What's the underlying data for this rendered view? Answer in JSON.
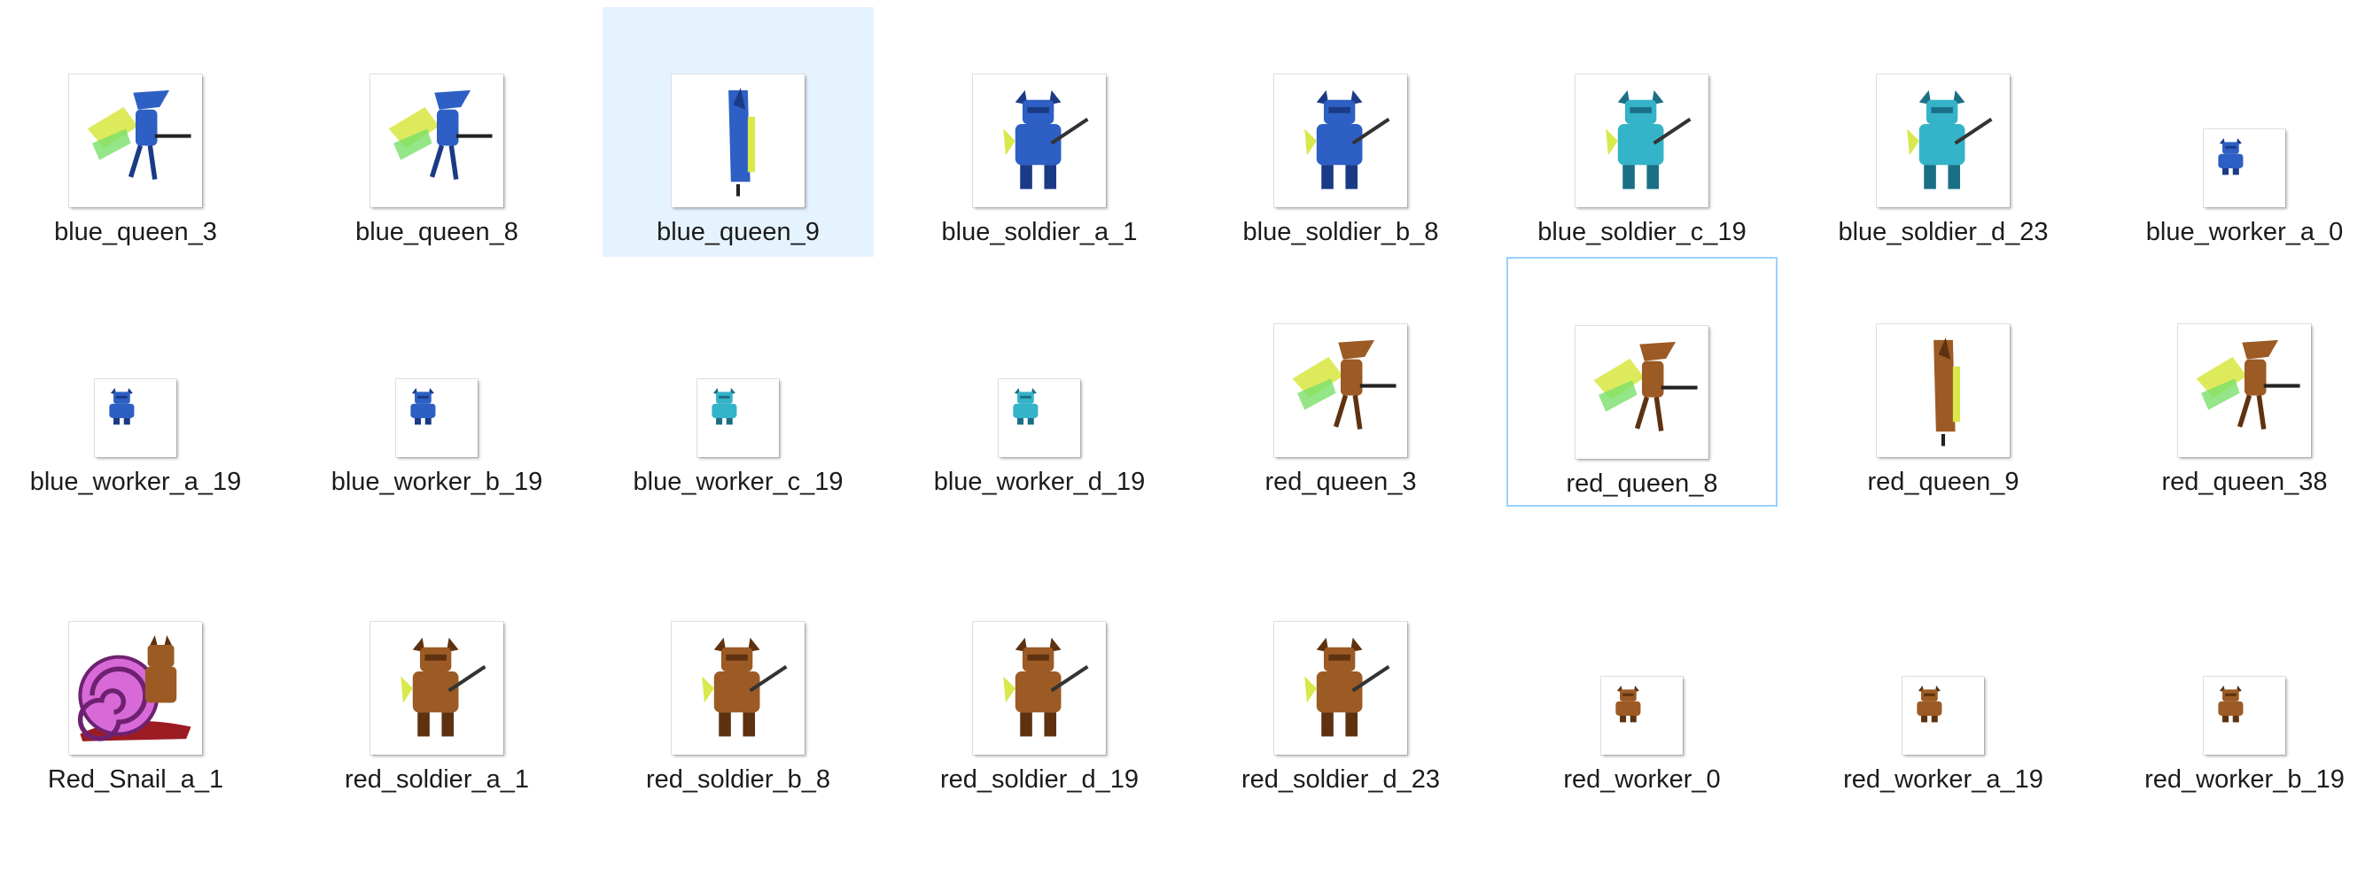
{
  "explorer": {
    "selected_index": 2,
    "focused_index": 13,
    "files": [
      {
        "name": "blue_queen_3",
        "icon": "blue-queen-sprite-icon",
        "kind": "queen",
        "team": "blue"
      },
      {
        "name": "blue_queen_8",
        "icon": "blue-queen-sprite-icon",
        "kind": "queen",
        "team": "blue"
      },
      {
        "name": "blue_queen_9",
        "icon": "blue-queen-sprite-icon",
        "kind": "queen-side",
        "team": "blue"
      },
      {
        "name": "blue_soldier_a_1",
        "icon": "blue-soldier-sprite-icon",
        "kind": "soldier",
        "team": "blue"
      },
      {
        "name": "blue_soldier_b_8",
        "icon": "blue-soldier-sprite-icon",
        "kind": "soldier",
        "team": "blue"
      },
      {
        "name": "blue_soldier_c_19",
        "icon": "blue-soldier-sprite-icon",
        "kind": "soldier",
        "team": "teal"
      },
      {
        "name": "blue_soldier_d_23",
        "icon": "blue-soldier-sprite-icon",
        "kind": "soldier",
        "team": "teal"
      },
      {
        "name": "blue_worker_a_0",
        "icon": "blue-worker-sprite-icon",
        "kind": "worker",
        "team": "blue"
      },
      {
        "name": "blue_worker_a_19",
        "icon": "blue-worker-sprite-icon",
        "kind": "worker",
        "team": "blue"
      },
      {
        "name": "blue_worker_b_19",
        "icon": "blue-worker-sprite-icon",
        "kind": "worker",
        "team": "blue"
      },
      {
        "name": "blue_worker_c_19",
        "icon": "blue-worker-sprite-icon",
        "kind": "worker",
        "team": "teal"
      },
      {
        "name": "blue_worker_d_19",
        "icon": "blue-worker-sprite-icon",
        "kind": "worker",
        "team": "teal"
      },
      {
        "name": "red_queen_3",
        "icon": "red-queen-sprite-icon",
        "kind": "queen",
        "team": "red"
      },
      {
        "name": "red_queen_8",
        "icon": "red-queen-sprite-icon",
        "kind": "queen",
        "team": "red"
      },
      {
        "name": "red_queen_9",
        "icon": "red-queen-sprite-icon",
        "kind": "queen-side",
        "team": "red"
      },
      {
        "name": "red_queen_38",
        "icon": "red-queen-sprite-icon",
        "kind": "queen",
        "team": "red"
      },
      {
        "name": "Red_Snail_a_1",
        "icon": "red-snail-sprite-icon",
        "kind": "snail",
        "team": "red"
      },
      {
        "name": "red_soldier_a_1",
        "icon": "red-soldier-sprite-icon",
        "kind": "soldier",
        "team": "red"
      },
      {
        "name": "red_soldier_b_8",
        "icon": "red-soldier-sprite-icon",
        "kind": "soldier",
        "team": "red"
      },
      {
        "name": "red_soldier_d_19",
        "icon": "red-soldier-sprite-icon",
        "kind": "soldier",
        "team": "red"
      },
      {
        "name": "red_soldier_d_23",
        "icon": "red-soldier-sprite-icon",
        "kind": "soldier",
        "team": "red"
      },
      {
        "name": "red_worker_0",
        "icon": "red-worker-sprite-icon",
        "kind": "worker",
        "team": "red"
      },
      {
        "name": "red_worker_a_19",
        "icon": "red-worker-sprite-icon",
        "kind": "worker",
        "team": "red"
      },
      {
        "name": "red_worker_b_19",
        "icon": "red-worker-sprite-icon",
        "kind": "worker",
        "team": "red"
      }
    ]
  },
  "colors": {
    "selection_bg": "#e5f3ff",
    "focus_border": "#99d1ff",
    "blue": "#2d5fc4",
    "teal": "#35b3c8",
    "red": "#9c5a24",
    "wing": "#d9e84a",
    "snail_shell": "#d86ad8"
  }
}
